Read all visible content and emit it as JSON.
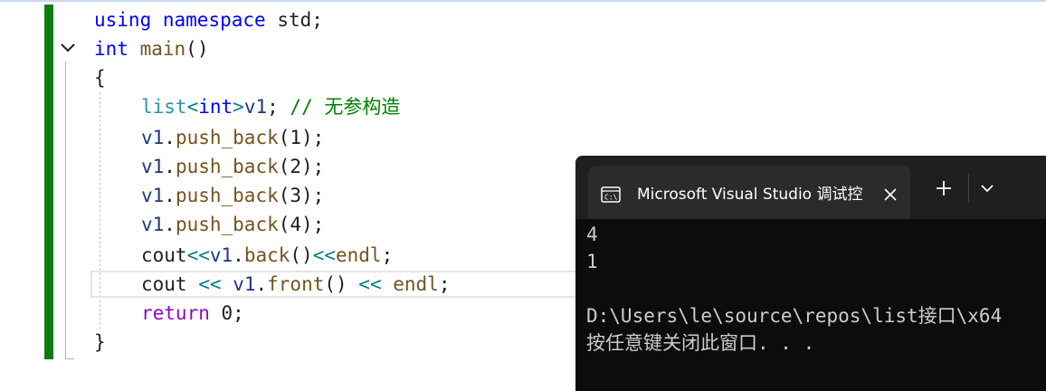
{
  "editor": {
    "lines": [
      {
        "tokens": [
          {
            "t": "using",
            "c": "kw"
          },
          {
            "t": " ",
            "c": "id"
          },
          {
            "t": "namespace",
            "c": "kw"
          },
          {
            "t": " std;",
            "c": "id"
          }
        ]
      },
      {
        "tokens": [
          {
            "t": "int",
            "c": "kw"
          },
          {
            "t": " ",
            "c": "id"
          },
          {
            "t": "main",
            "c": "fn"
          },
          {
            "t": "()",
            "c": "id"
          }
        ]
      },
      {
        "tokens": [
          {
            "t": "{",
            "c": "id"
          }
        ]
      },
      {
        "tokens": [
          {
            "t": "list",
            "c": "ty"
          },
          {
            "t": "<",
            "c": "op"
          },
          {
            "t": "int",
            "c": "kw"
          },
          {
            "t": ">",
            "c": "op"
          },
          {
            "t": "v1",
            "c": "var"
          },
          {
            "t": "; ",
            "c": "id"
          },
          {
            "t": "// 无参构造",
            "c": "cm"
          }
        ]
      },
      {
        "tokens": [
          {
            "t": "v1",
            "c": "var"
          },
          {
            "t": ".",
            "c": "id"
          },
          {
            "t": "push_back",
            "c": "fn"
          },
          {
            "t": "(1);",
            "c": "id"
          }
        ]
      },
      {
        "tokens": [
          {
            "t": "v1",
            "c": "var"
          },
          {
            "t": ".",
            "c": "id"
          },
          {
            "t": "push_back",
            "c": "fn"
          },
          {
            "t": "(2);",
            "c": "id"
          }
        ]
      },
      {
        "tokens": [
          {
            "t": "v1",
            "c": "var"
          },
          {
            "t": ".",
            "c": "id"
          },
          {
            "t": "push_back",
            "c": "fn"
          },
          {
            "t": "(3);",
            "c": "id"
          }
        ]
      },
      {
        "tokens": [
          {
            "t": "v1",
            "c": "var"
          },
          {
            "t": ".",
            "c": "id"
          },
          {
            "t": "push_back",
            "c": "fn"
          },
          {
            "t": "(4);",
            "c": "id"
          }
        ]
      },
      {
        "tokens": [
          {
            "t": "cout",
            "c": "id"
          },
          {
            "t": "<<",
            "c": "op"
          },
          {
            "t": "v1",
            "c": "var"
          },
          {
            "t": ".",
            "c": "id"
          },
          {
            "t": "back",
            "c": "fn"
          },
          {
            "t": "()",
            "c": "id"
          },
          {
            "t": "<<",
            "c": "op"
          },
          {
            "t": "endl",
            "c": "fn"
          },
          {
            "t": ";",
            "c": "id"
          }
        ]
      },
      {
        "tokens": [
          {
            "t": "cout",
            "c": "id"
          },
          {
            "t": " ",
            "c": "id"
          },
          {
            "t": "<<",
            "c": "op"
          },
          {
            "t": " ",
            "c": "id"
          },
          {
            "t": "v1",
            "c": "var"
          },
          {
            "t": ".",
            "c": "id"
          },
          {
            "t": "front",
            "c": "fn"
          },
          {
            "t": "() ",
            "c": "id"
          },
          {
            "t": "<<",
            "c": "op"
          },
          {
            "t": " ",
            "c": "id"
          },
          {
            "t": "endl",
            "c": "fn"
          },
          {
            "t": ";",
            "c": "id"
          }
        ]
      },
      {
        "tokens": [
          {
            "t": "return",
            "c": "ctl"
          },
          {
            "t": " 0;",
            "c": "id"
          }
        ]
      },
      {
        "tokens": [
          {
            "t": "}",
            "c": "id"
          }
        ]
      }
    ],
    "fold_icon": "chevron-down-icon"
  },
  "console": {
    "tab_icon": "console-icon",
    "title": "Microsoft Visual Studio 调试控",
    "close_icon": "close-icon",
    "new_tab_icon": "plus-icon",
    "dropdown_icon": "chevron-down-icon",
    "output": [
      "4",
      "1",
      "",
      "D:\\Users\\le\\source\\repos\\list接口\\x64",
      "按任意键关闭此窗口. . ."
    ]
  },
  "colors": {
    "keyword": "#0000ff",
    "type": "#2b91af",
    "function": "#74531f",
    "comment": "#008000",
    "operator": "#008080",
    "control": "#8f08c4",
    "variable": "#1f377f",
    "change_bar": "#107c10",
    "console_bg": "#0c0c0c",
    "console_text": "#cccccc"
  }
}
